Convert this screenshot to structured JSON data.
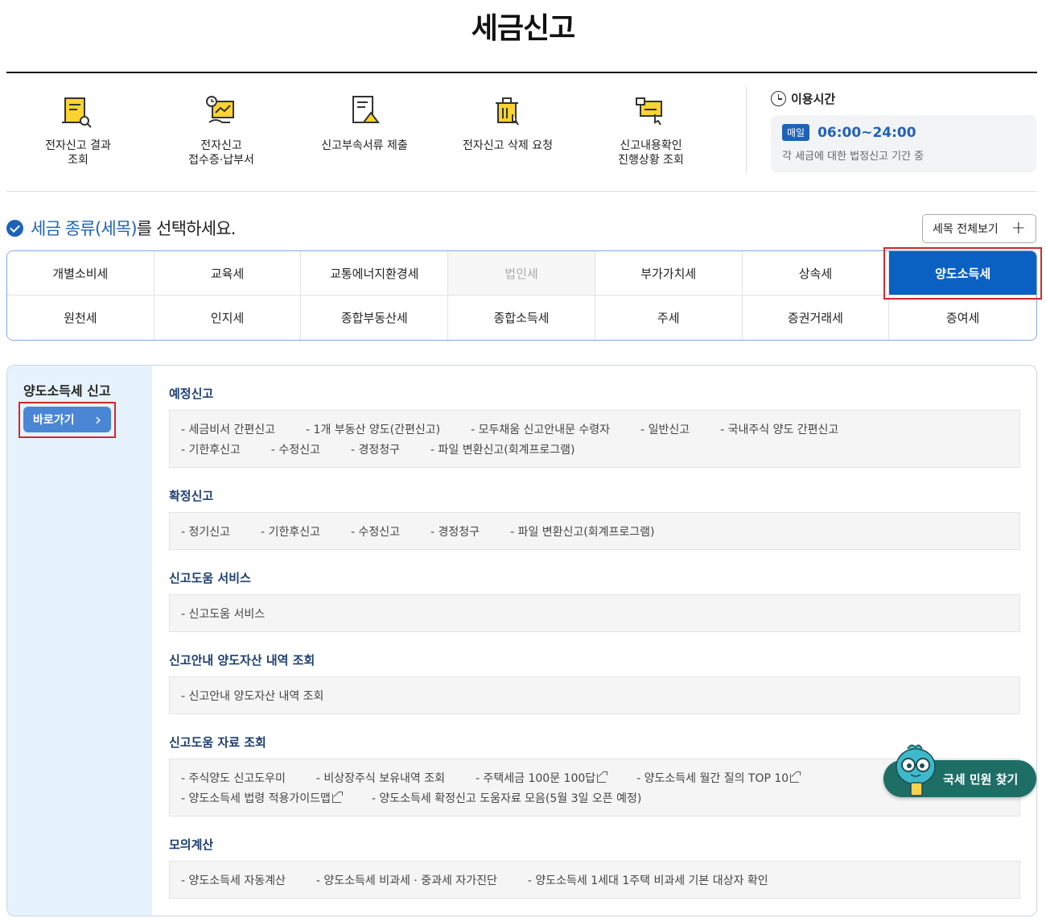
{
  "page": {
    "title": "세금신고"
  },
  "quick_menu": [
    {
      "label": "전자신고 결과\n조회",
      "icon": "search-document-icon"
    },
    {
      "label": "전자신고\n접수증·납부서",
      "icon": "receipt-clock-icon"
    },
    {
      "label": "신고부속서류 제출",
      "icon": "document-upload-icon"
    },
    {
      "label": "전자신고 삭제 요청",
      "icon": "trash-click-icon"
    },
    {
      "label": "신고내용확인\n진행상황 조회",
      "icon": "progress-check-icon"
    }
  ],
  "hours": {
    "title": "이용시간",
    "badge": "매일",
    "time": "06:00~24:00",
    "note": "각 세금에 대한 법정신고 기간 중"
  },
  "select_heading": {
    "blue": "세금 종류(세목)",
    "black": "를 선택하세요."
  },
  "view_all": {
    "label": "세목 전체보기",
    "icon": "+"
  },
  "tax_types": [
    "개별소비세",
    "교육세",
    "교통에너지환경세",
    "법인세",
    "부가가치세",
    "상속세",
    "양도소득세",
    "원천세",
    "인지세",
    "종합부동산세",
    "종합소득세",
    "주세",
    "증권거래세",
    "증여세"
  ],
  "selected_tax": "양도소득세",
  "panel": {
    "side_title": "양도소득세 신고",
    "go_button": "바로가기",
    "go_icon": "›",
    "sections": [
      {
        "title": "예정신고",
        "rows": [
          [
            "세금비서 간편신고",
            "1개 부동산 양도(간편신고)",
            "모두채움 신고안내문 수령자",
            "일반신고",
            "국내주식 양도 간편신고"
          ],
          [
            "기한후신고",
            "수정신고",
            "경정청구",
            "파일 변환신고(회계프로그램)"
          ]
        ]
      },
      {
        "title": "확정신고",
        "rows": [
          [
            "정기신고",
            "기한후신고",
            "수정신고",
            "경정청구",
            "파일 변환신고(회계프로그램)"
          ]
        ]
      },
      {
        "title": "신고도움 서비스",
        "rows": [
          [
            "신고도움 서비스"
          ]
        ]
      },
      {
        "title": "신고안내 양도자산 내역 조회",
        "rows": [
          [
            "신고안내 양도자산 내역 조회"
          ]
        ]
      },
      {
        "title": "신고도움 자료 조회",
        "rows": [
          [
            "주식양도 신고도우미",
            "비상장주식 보유내역 조회",
            "주택세금 100문 100답",
            "양도소득세 월간 질의 TOP 10"
          ],
          [
            "양도소득세 법령 적용가이드맵",
            "양도소득세 확정신고 도움자료 모음(5월 3일 오픈 예정)"
          ]
        ]
      },
      {
        "title": "모의계산",
        "rows": [
          [
            "양도소득세 자동계산",
            "양도소득세 비과세 · 중과세 자가진단",
            "양도소득세 1세대 1주택 비과세 기본 대상자 확인"
          ]
        ]
      }
    ]
  },
  "chatbot": {
    "label": "국세 민원 찾기"
  },
  "colors": {
    "brand_blue": "#1f62b9",
    "active_tab": "#0b61c2",
    "highlight_red": "#d6262b",
    "chat_green": "#1e6e66"
  }
}
